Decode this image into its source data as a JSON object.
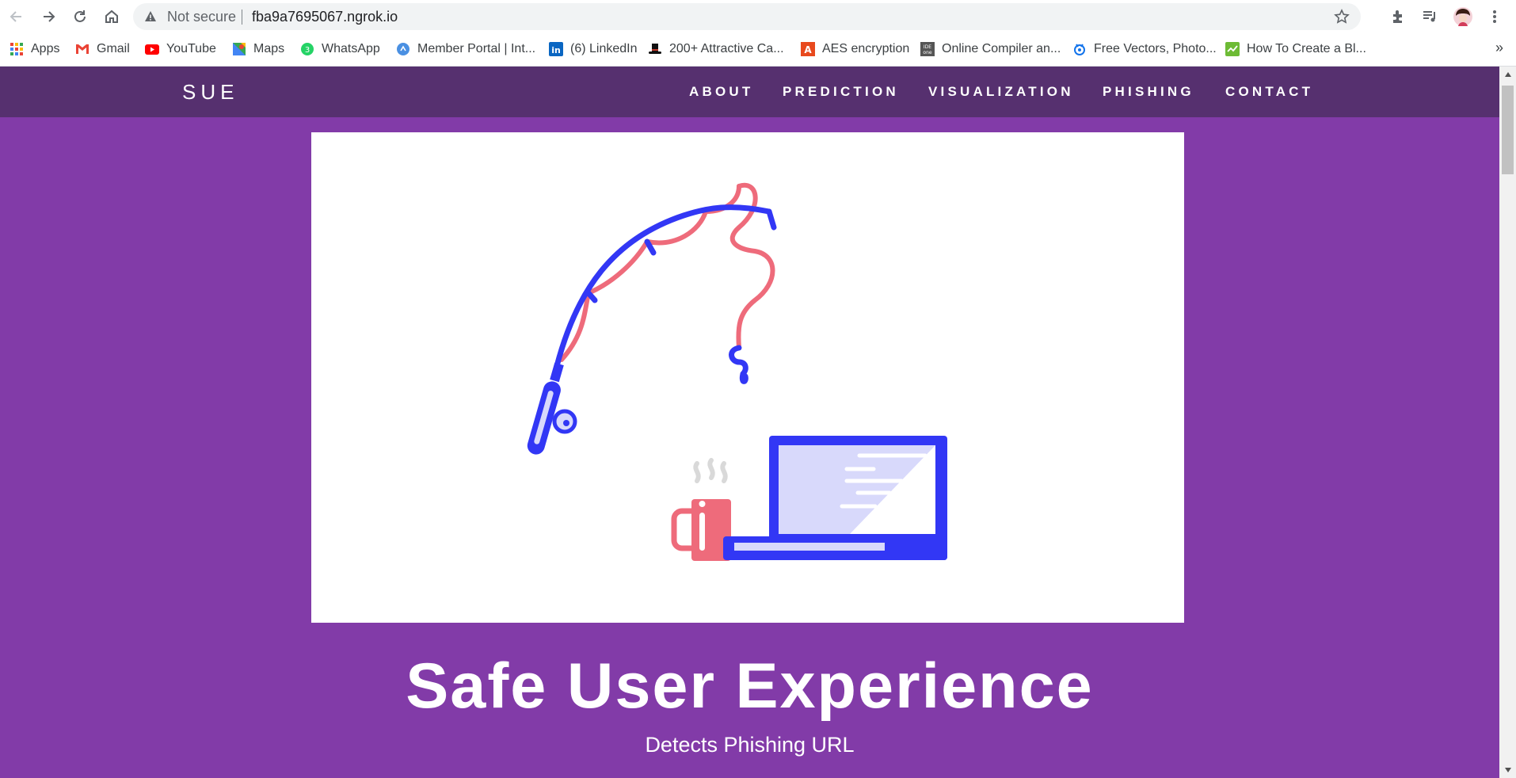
{
  "browser": {
    "security_label": "Not secure",
    "url": "fba9a7695067.ngrok.io",
    "bookmarks": [
      {
        "label": "Apps",
        "icon": "apps-grid-icon"
      },
      {
        "label": "Gmail",
        "icon": "gmail-icon"
      },
      {
        "label": "YouTube",
        "icon": "youtube-icon"
      },
      {
        "label": "Maps",
        "icon": "maps-icon"
      },
      {
        "label": "WhatsApp",
        "icon": "whatsapp-icon"
      },
      {
        "label": "Member Portal | Int...",
        "icon": "member-portal-icon"
      },
      {
        "label": "(6) LinkedIn",
        "icon": "linkedin-icon"
      },
      {
        "label": "200+ Attractive Ca...",
        "icon": "top-hat-icon"
      },
      {
        "label": "AES encryption",
        "icon": "aes-icon"
      },
      {
        "label": "Online Compiler an...",
        "icon": "ideone-icon"
      },
      {
        "label": "Free Vectors, Photo...",
        "icon": "freepik-icon"
      },
      {
        "label": "How To Create a Bl...",
        "icon": "blog-icon"
      }
    ],
    "more_label": "»"
  },
  "site": {
    "brand": "SUE",
    "menu": [
      "ABOUT",
      "PREDICTION",
      "VISUALIZATION",
      "PHISHING",
      "CONTACT"
    ],
    "hero_title": "Safe User Experience",
    "hero_subtitle": "Detects Phishing URL"
  },
  "colors": {
    "nav_bg": "#56306f",
    "page_bg": "#823ba8",
    "illustration_blue": "#3237f5",
    "illustration_pink": "#ee6b7b",
    "illustration_light": "#d8d9fb"
  }
}
